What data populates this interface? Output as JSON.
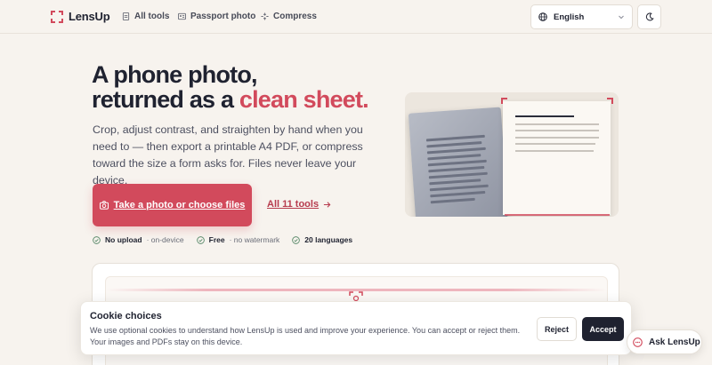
{
  "brand": {
    "name": "LensUp",
    "accent": "#d24a5c"
  },
  "nav": {
    "items": [
      {
        "label": "All tools",
        "icon": "document-icon"
      },
      {
        "label": "Passport photo",
        "icon": "id-card-icon"
      },
      {
        "label": "Compress",
        "icon": "compress-icon"
      }
    ]
  },
  "language": {
    "selected": "English",
    "icon": "globe-icon"
  },
  "theme_toggle": {
    "icon": "moon-icon"
  },
  "hero": {
    "headline_line1": "A phone photo,",
    "headline_line2_prefix": "returned as a ",
    "headline_line2_accent": "clean sheet.",
    "lede": "Crop, adjust contrast, and straighten by hand when you need to — then export a printable A4 PDF, or compress toward the size a form asks for. Files never leave your device.",
    "cta_label": "Take a photo or choose files",
    "tools_link": "All 11 tools"
  },
  "badges": [
    {
      "strong": "No upload",
      "muted": "· on-device"
    },
    {
      "strong": "Free",
      "muted": "· no watermark"
    },
    {
      "strong": "20 languages",
      "muted": ""
    }
  ],
  "cookie": {
    "title": "Cookie choices",
    "text": "We use optional cookies to understand how LensUp is used and improve your experience. You can accept or reject them. Your images and PDFs stay on this device.",
    "reject_label": "Reject",
    "accept_label": "Accept"
  },
  "assistant": {
    "label": "Ask LensUp",
    "icon": "chat-icon"
  }
}
